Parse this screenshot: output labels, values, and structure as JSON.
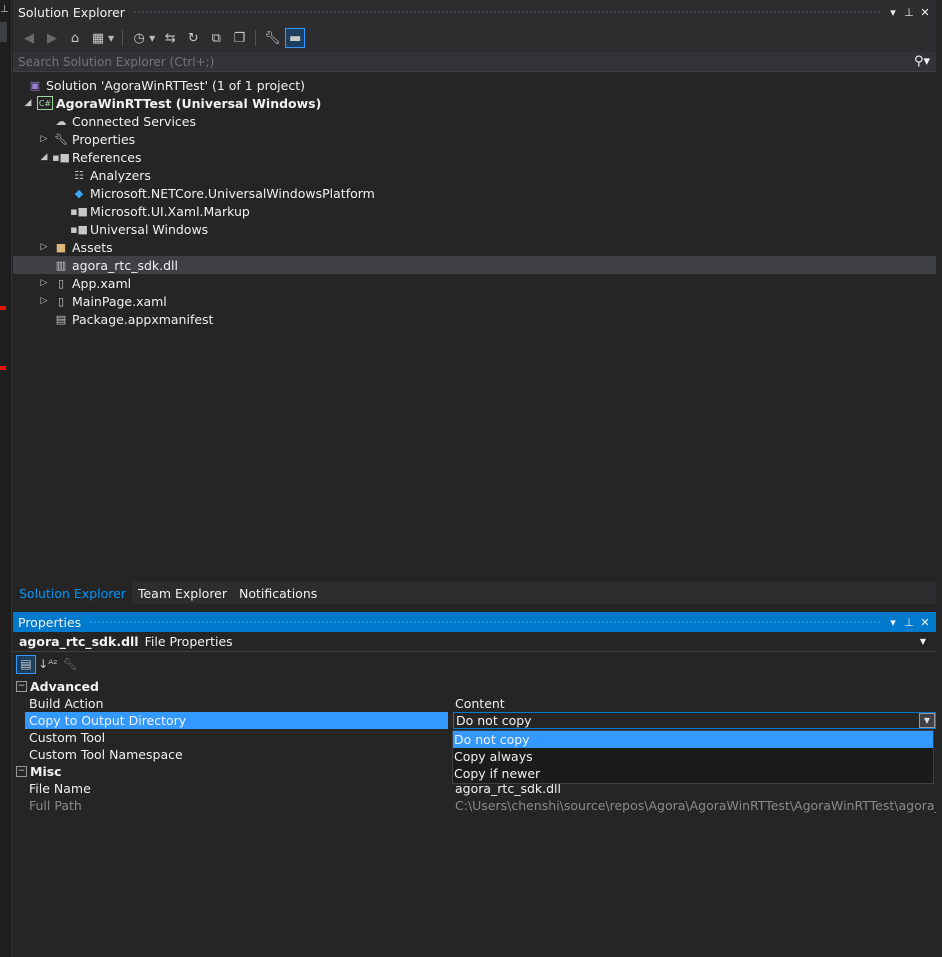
{
  "solution_explorer": {
    "title": "Solution Explorer",
    "title_buttons": [
      "▾",
      "⊥",
      "✕"
    ],
    "search_placeholder": "Search Solution Explorer (Ctrl+;)",
    "tree": [
      {
        "label": "Solution 'AgoraWinRTTest' (1 of 1 project)",
        "icon": "solution-icon",
        "level": 0,
        "arrow": ""
      },
      {
        "label": "AgoraWinRTTest (Universal Windows)",
        "icon": "csharp-project-icon",
        "level": 0,
        "arrow": "expanded",
        "bold": true
      },
      {
        "label": "Connected Services",
        "icon": "connected-services-icon",
        "level": 1,
        "arrow": ""
      },
      {
        "label": "Properties",
        "icon": "wrench-icon",
        "level": 1,
        "arrow": "collapsed"
      },
      {
        "label": "References",
        "icon": "references-icon",
        "level": 1,
        "arrow": "expanded"
      },
      {
        "label": "Analyzers",
        "icon": "analyzers-icon",
        "level": 2,
        "arrow": ""
      },
      {
        "label": "Microsoft.NETCore.UniversalWindowsPlatform",
        "icon": "nuget-package-icon",
        "level": 2,
        "arrow": ""
      },
      {
        "label": "Microsoft.UI.Xaml.Markup",
        "icon": "reference-icon",
        "level": 2,
        "arrow": ""
      },
      {
        "label": "Universal Windows",
        "icon": "reference-icon",
        "level": 2,
        "arrow": ""
      },
      {
        "label": "Assets",
        "icon": "folder-icon",
        "level": 1,
        "arrow": "collapsed"
      },
      {
        "label": "agora_rtc_sdk.dll",
        "icon": "dll-icon",
        "level": 1,
        "arrow": "",
        "selected": true
      },
      {
        "label": "App.xaml",
        "icon": "xaml-file-icon",
        "level": 1,
        "arrow": "collapsed"
      },
      {
        "label": "MainPage.xaml",
        "icon": "xaml-file-icon",
        "level": 1,
        "arrow": "collapsed"
      },
      {
        "label": "Package.appxmanifest",
        "icon": "manifest-icon",
        "level": 1,
        "arrow": ""
      }
    ]
  },
  "bottom_tabs": [
    "Solution Explorer",
    "Team Explorer",
    "Notifications"
  ],
  "properties": {
    "title": "Properties",
    "title_buttons": [
      "▾",
      "⊥",
      "✕"
    ],
    "object_name": "agora_rtc_sdk.dll",
    "object_type": "File Properties",
    "categories": [
      {
        "name": "Advanced",
        "rows": [
          {
            "name": "Build Action",
            "value": "Content"
          },
          {
            "name": "Copy to Output Directory",
            "value": "Do not copy",
            "selected": true
          },
          {
            "name": "Custom Tool",
            "value": ""
          },
          {
            "name": "Custom Tool Namespace",
            "value": ""
          }
        ]
      },
      {
        "name": "Misc",
        "rows": [
          {
            "name": "File Name",
            "value": "agora_rtc_sdk.dll"
          },
          {
            "name": "Full Path",
            "value": "C:\\Users\\chenshi\\source\\repos\\Agora\\AgoraWinRTTest\\AgoraWinRTTest\\agora_rtc_",
            "readonly": true
          }
        ]
      }
    ],
    "dropdown_options": [
      "Do not copy",
      "Copy always",
      "Copy if newer"
    ],
    "dropdown_highlighted": "Do not copy"
  },
  "colors": {
    "accent": "#007acc",
    "selection": "#3399ff",
    "background": "#252526"
  }
}
